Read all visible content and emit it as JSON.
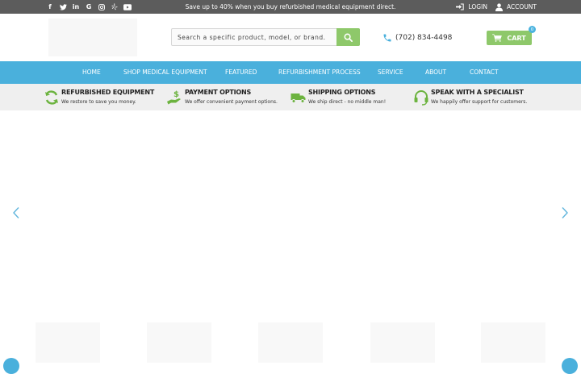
{
  "topbar": {
    "promo": "Save up to 40% when you buy refurbished medical equipment direct.",
    "social_icons": [
      "facebook-icon",
      "twitter-icon",
      "linkedin-icon",
      "google-icon",
      "instagram-icon",
      "yelp-icon",
      "youtube-icon"
    ],
    "login_label": "LOGIN",
    "account_label": "ACCOUNT"
  },
  "header": {
    "search_placeholder": "Search a specific product, model, or brand.",
    "phone": "(702) 834-4498",
    "cart_label": "CART",
    "cart_count": "0"
  },
  "nav": {
    "items": [
      {
        "label": "HOME"
      },
      {
        "label": "SHOP MEDICAL EQUIPMENT"
      },
      {
        "label": "FEATURED"
      },
      {
        "label": "REFURBISHMENT PROCESS"
      },
      {
        "label": "SERVICE"
      },
      {
        "label": "ABOUT"
      },
      {
        "label": "CONTACT"
      }
    ]
  },
  "features": [
    {
      "title": "REFURBISHED EQUIPMENT",
      "subtitle": "We restore to save you money.",
      "icon": "refresh-icon"
    },
    {
      "title": "PAYMENT OPTIONS",
      "subtitle": "We offer convenient payment options.",
      "icon": "dollar-hand-icon"
    },
    {
      "title": "SHIPPING OPTIONS",
      "subtitle": "We ship direct - no middle man!",
      "icon": "truck-icon"
    },
    {
      "title": "SPEAK WITH A SPECIALIST",
      "subtitle": "We happily offer support for customers.",
      "icon": "headset-icon"
    }
  ],
  "colors": {
    "topbar": "#5c5c5c",
    "nav": "#4ab0dc",
    "accent_green": "#8ec86a",
    "feature_bar": "#efefef"
  }
}
